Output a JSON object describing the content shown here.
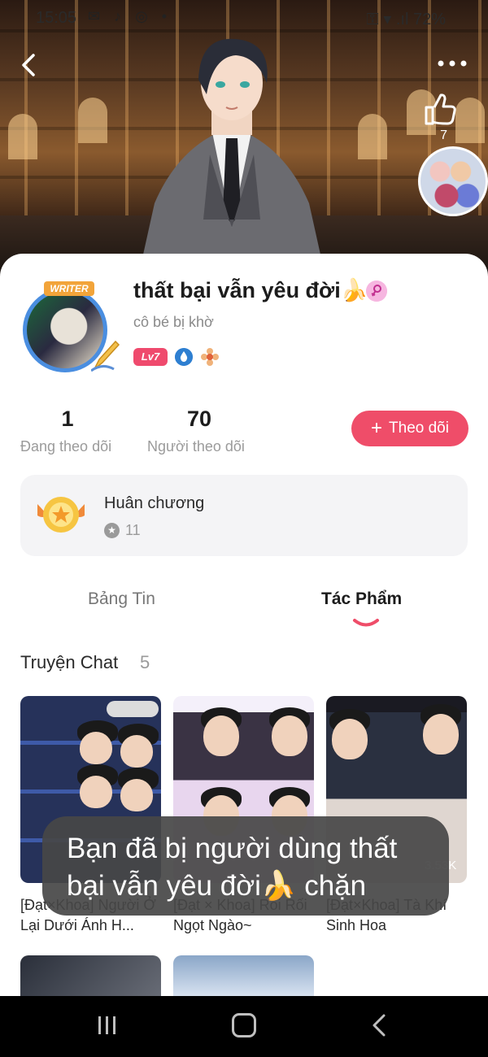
{
  "status_bar": {
    "time": "15:05",
    "left_icons": "✉ ♪ ◎ •",
    "right_text": "⚿ ▾ .ıl 72%"
  },
  "header": {
    "like_count": "7"
  },
  "profile": {
    "avatar_badge": "WRITER",
    "username": "thất bại vẫn yêu đời🍌",
    "bio": "cô bé bị khờ",
    "level": "Lv7"
  },
  "stats": {
    "following_count": "1",
    "following_label": "Đang theo dõi",
    "followers_count": "70",
    "followers_label": "Người theo dõi"
  },
  "follow_button": {
    "plus": "+",
    "label": "Theo dõi"
  },
  "medal": {
    "title": "Huân chương",
    "count": "11"
  },
  "tabs": [
    {
      "label": "Bảng Tin",
      "active": false
    },
    {
      "label": "Tác Phẩm",
      "active": true
    }
  ],
  "section": {
    "title": "Truyện Chat",
    "count": "5"
  },
  "stories": [
    {
      "title": "[Đạt×Khoa] Người Ở Lại Dưới Ánh H..."
    },
    {
      "title": "[Đạt × Khoa] Rối Rối Ngọt Ngào~"
    },
    {
      "title": "[Đạt×Khoa] Tà Khí Sinh Hoa",
      "views": "3.53K"
    }
  ],
  "toast": {
    "message": "Bạn đã bị người dùng thất bại vẫn yêu đời🍌 chặn"
  },
  "colors": {
    "accent": "#ef4d69",
    "level_badge": "#ef4a6d",
    "avatar_ring": "#4a8ee0",
    "toast_bg": "#464646"
  }
}
